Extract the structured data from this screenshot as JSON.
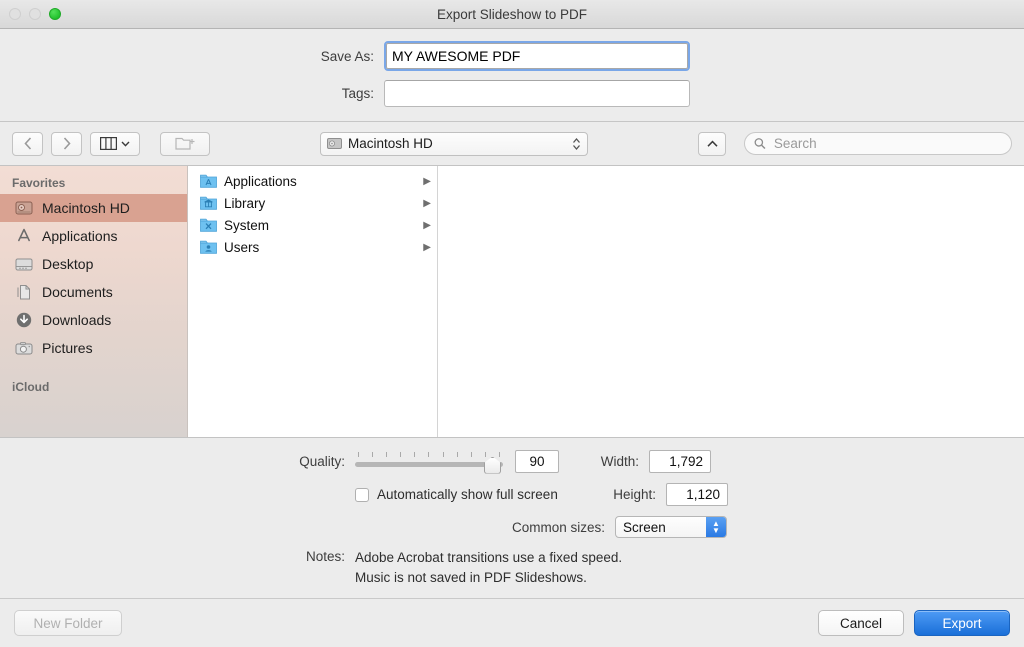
{
  "window": {
    "title": "Export Slideshow to PDF",
    "traffic_lights": [
      "close-disabled",
      "minimize-disabled",
      "zoom-green"
    ]
  },
  "form": {
    "save_as_label": "Save As:",
    "save_as_value": "MY AWESOME PDF",
    "tags_label": "Tags:",
    "tags_value": "",
    "tags_placeholder": ""
  },
  "toolbar": {
    "back_icon": "chevron-left-icon",
    "forward_icon": "chevron-right-icon",
    "view_icon": "column-view-icon",
    "view_chevron": "chevron-down-icon",
    "new_folder_icon": "new-folder-icon",
    "path_value": "Macintosh HD",
    "path_icon": "hard-drive-icon",
    "up_icon": "chevron-up-icon",
    "search_placeholder": "Search",
    "search_value": "",
    "search_icon": "search-icon"
  },
  "sidebar": {
    "sections": [
      {
        "header": "Favorites",
        "items": [
          {
            "label": "Macintosh HD",
            "icon": "hard-drive-icon",
            "selected": true
          },
          {
            "label": "Applications",
            "icon": "applications-icon",
            "selected": false
          },
          {
            "label": "Desktop",
            "icon": "desktop-icon",
            "selected": false
          },
          {
            "label": "Documents",
            "icon": "documents-icon",
            "selected": false
          },
          {
            "label": "Downloads",
            "icon": "downloads-icon",
            "selected": false
          },
          {
            "label": "Pictures",
            "icon": "pictures-icon",
            "selected": false
          }
        ]
      },
      {
        "header": "iCloud",
        "items": []
      }
    ]
  },
  "filebrowser": {
    "column1": [
      {
        "name": "Applications",
        "icon": "folder-applications-icon",
        "has_children": true
      },
      {
        "name": "Library",
        "icon": "folder-library-icon",
        "has_children": true
      },
      {
        "name": "System",
        "icon": "folder-system-icon",
        "has_children": true
      },
      {
        "name": "Users",
        "icon": "folder-users-icon",
        "has_children": true
      }
    ]
  },
  "options": {
    "quality_label": "Quality:",
    "quality_value": "90",
    "quality_ticks": 11,
    "quality_percent": 88,
    "fullscreen_label": "Automatically show full screen",
    "fullscreen_checked": false,
    "width_label": "Width:",
    "width_value": "1,792",
    "height_label": "Height:",
    "height_value": "1,120",
    "common_sizes_label": "Common sizes:",
    "common_sizes_value": "Screen",
    "notes_label": "Notes:",
    "notes_line1": "Adobe Acrobat transitions use a fixed speed.",
    "notes_line2": "Music is not saved in PDF Slideshows."
  },
  "buttons": {
    "new_folder": "New Folder",
    "cancel": "Cancel",
    "export": "Export"
  },
  "colors": {
    "accent_blue": "#1a6fd8",
    "focus_ring": "#7aa7e8",
    "sidebar_selection": "#d9a291",
    "folder_blue": "#6ec1f0"
  }
}
